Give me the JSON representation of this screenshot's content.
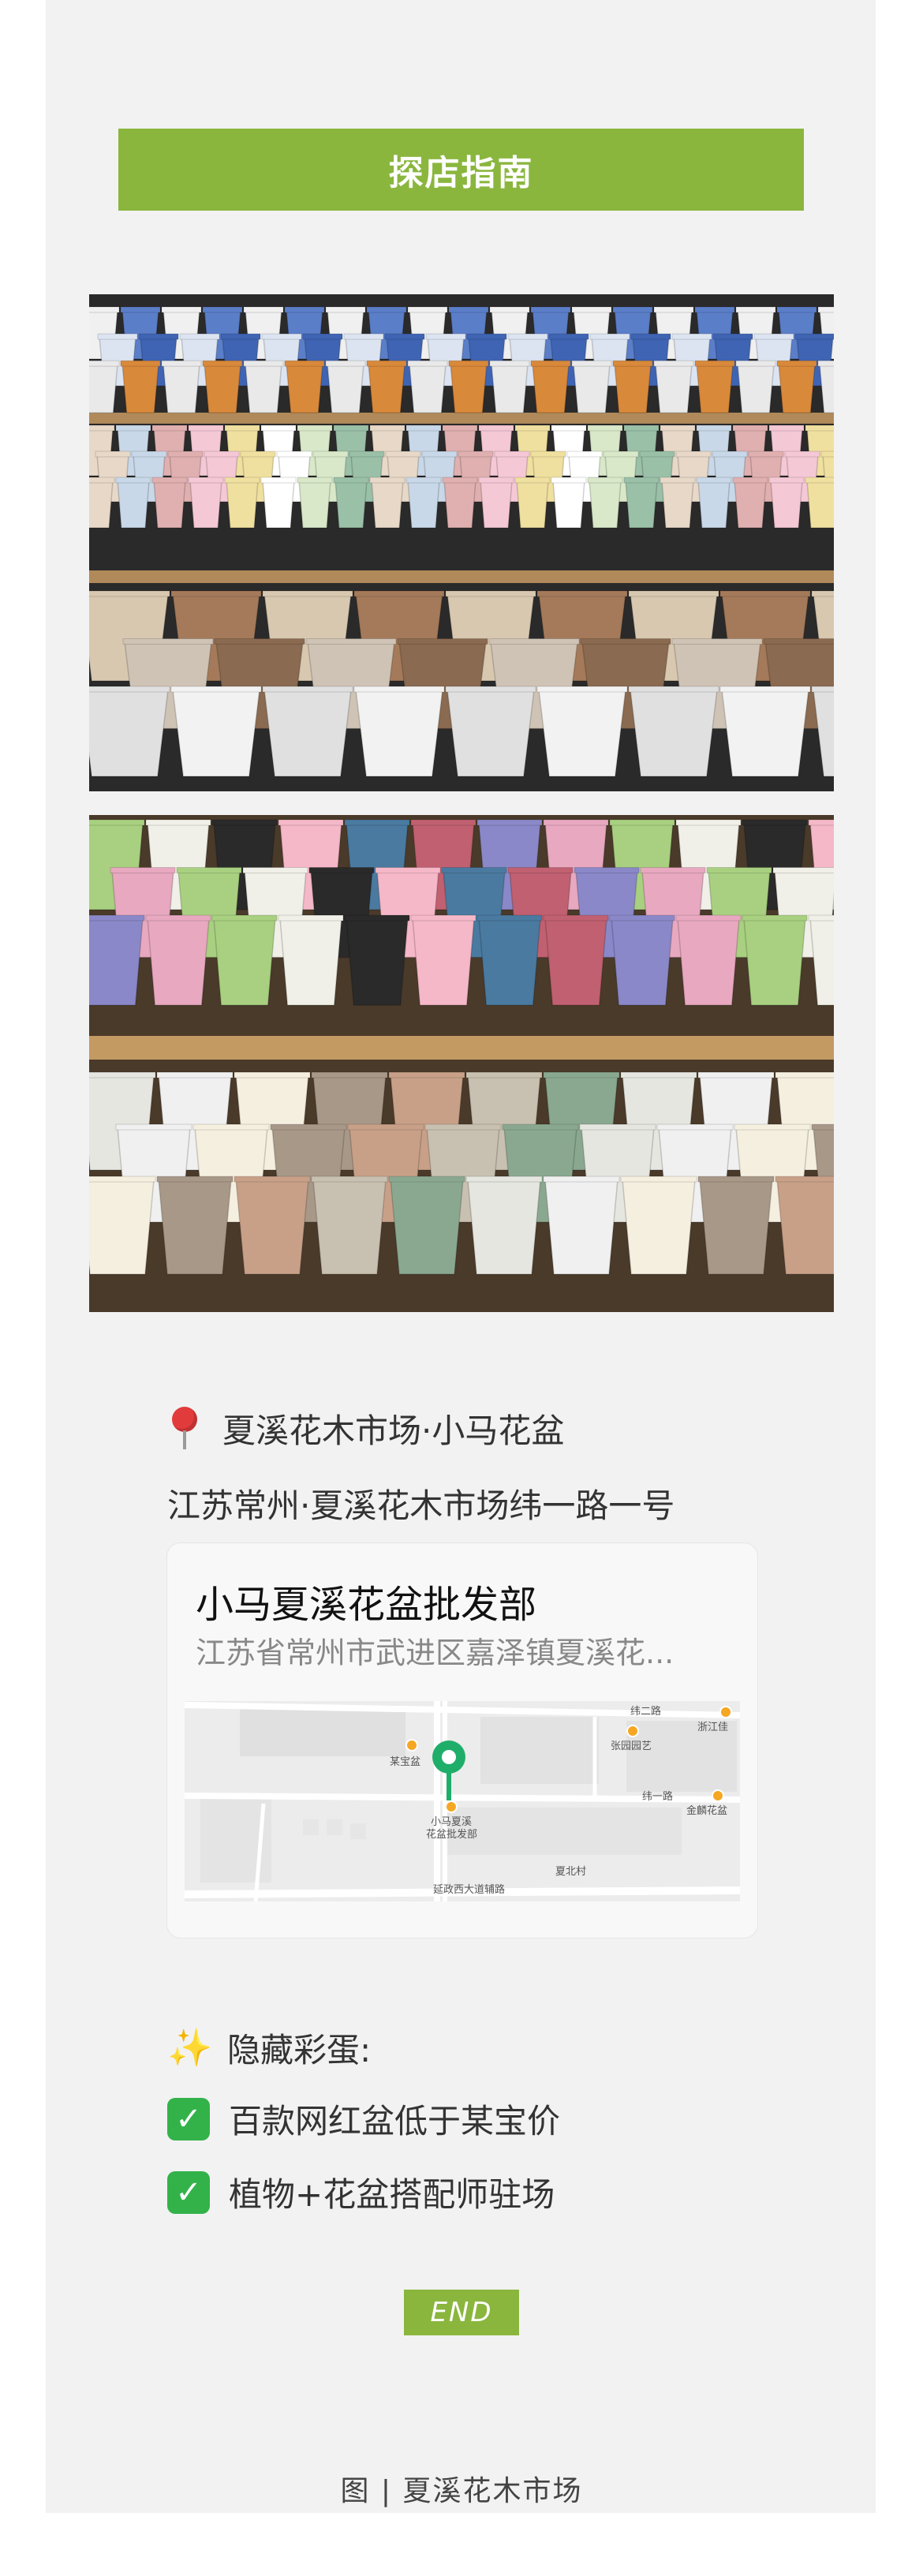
{
  "banner": {
    "title": "探店指南"
  },
  "location": {
    "name": "夏溪花木市场·小马花盆",
    "address": "江苏常州·夏溪花木市场纬一路一号"
  },
  "map_card": {
    "title": "小马夏溪花盆批发部",
    "address": "江苏省常州市武进区嘉泽镇夏溪花...",
    "labels": {
      "road_top": "纬二路",
      "road_mid": "纬一路",
      "road_bottom": "延政西大道辅路",
      "poi_1": "某宝盆",
      "poi_2": "张园园艺",
      "poi_3": "浙江佳",
      "poi_4": "金麟花盆",
      "poi_5": "夏北村",
      "poi_main_1": "小马夏溪",
      "poi_main_2": "花盆批发部"
    }
  },
  "easter_egg": {
    "title": "隐藏彩蛋:",
    "items": [
      "百款网红盆低于某宝价",
      "植物+花盆搭配师驻场"
    ]
  },
  "end_label": "END",
  "caption": "图 | 夏溪花木市场",
  "colors": {
    "accent": "#8ab63e",
    "check": "#33b24a",
    "pin": "#e23b3b"
  }
}
